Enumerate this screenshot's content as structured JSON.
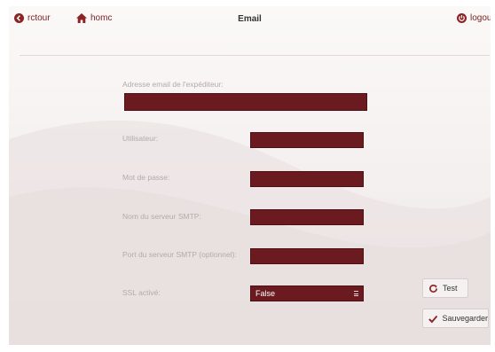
{
  "nav": {
    "back_label": "rctour",
    "home_label": "homc",
    "logout_label": "logout",
    "title": "Email"
  },
  "form": {
    "sender_email_label": "Adresse email de l'expéditeur:",
    "sender_email_value": "",
    "user_label": "Utilisateur:",
    "user_value": "",
    "password_label": "Mot de passe:",
    "password_value": "",
    "smtp_server_label": "Nom du serveur SMTP:",
    "smtp_server_value": "",
    "smtp_port_label": "Port du serveur SMTP (optionnel):",
    "smtp_port_value": "",
    "ssl_label": "SSL activé:",
    "ssl_selected": "False"
  },
  "actions": {
    "test_label": "Test",
    "save_label": "Sauvegarder"
  },
  "colors": {
    "accent": "#7a1e1e",
    "field_fill": "#6b1a1f",
    "background": "#f3efee"
  },
  "icons": {
    "back": "back-arrow-circle-icon",
    "home": "home-icon",
    "logout": "power-icon",
    "test": "refresh-icon",
    "save": "checkmark-icon",
    "select": "menu-lines-icon"
  }
}
